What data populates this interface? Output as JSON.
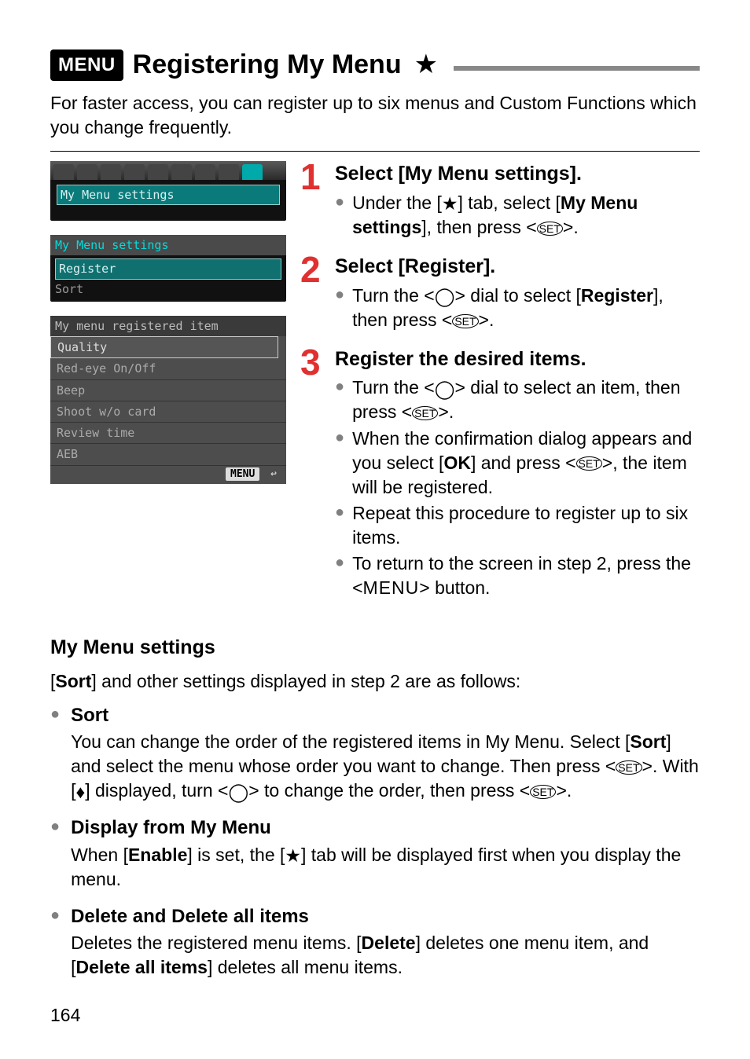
{
  "header": {
    "menu_badge": "MENU",
    "title": "Registering My Menu",
    "star": "★"
  },
  "intro": "For faster access, you can register up to six menus and Custom Functions which you change frequently.",
  "screens": {
    "s1_item": "My Menu settings",
    "s2_header": "My Menu settings",
    "s2_item1": "Register",
    "s2_item2": "Sort",
    "s3_header": "My menu registered item",
    "s3_items": [
      "Quality",
      "Red-eye On/Off",
      "Beep",
      "Shoot w/o card",
      "Review time",
      "AEB"
    ],
    "s3_menu": "MENU",
    "s3_return": "↩"
  },
  "steps": {
    "s1": {
      "num": "1",
      "head": "Select [My Menu settings].",
      "b1_pre": "Under the [",
      "b1_icon": "★",
      "b1_mid": "] tab, select [",
      "b1_bold": "My Menu settings",
      "b1_post": "], then press <",
      "b1_set": "SET",
      "b1_end": ">."
    },
    "s2": {
      "num": "2",
      "head": "Select [Register].",
      "b1_pre": "Turn the <",
      "b1_dial": "◯",
      "b1_mid": "> dial to select [",
      "b1_bold": "Register",
      "b1_post": "], then press <",
      "b1_set": "SET",
      "b1_end": ">."
    },
    "s3": {
      "num": "3",
      "head": "Register the desired items.",
      "b1_pre": "Turn the <",
      "b1_dial": "◯",
      "b1_mid": "> dial to select an item, then press <",
      "b1_set": "SET",
      "b1_end": ">.",
      "b2_pre": "When the confirmation dialog appears and you select [",
      "b2_ok": "OK",
      "b2_mid": "] and press <",
      "b2_set": "SET",
      "b2_end": ">, the item will be registered.",
      "b3": "Repeat this procedure to register up to six items.",
      "b4_pre": "To return to the screen in step 2, press the <",
      "b4_menu": "MENU",
      "b4_end": "> button."
    }
  },
  "section_header": "My Menu settings",
  "after_step_pre": "[",
  "after_step_bold": "Sort",
  "after_step_post": "] and other settings displayed in step 2 are as follows:",
  "settings": {
    "sort": {
      "title": "Sort",
      "t1": "You can change the order of the registered items in My Menu. Select [",
      "t1b": "Sort",
      "t2": "] and select the menu whose order you want to change. Then press <",
      "set1": "SET",
      "t3": ">. With [",
      "arrow": "♦",
      "t4": "] displayed, turn <",
      "dial": "◯",
      "t5": "> to change the order, then press <",
      "set2": "SET",
      "t6": ">."
    },
    "display": {
      "title": "Display from My Menu",
      "t1": "When [",
      "enable": "Enable",
      "t2": "] is set, the [",
      "icon": "★",
      "t3": "] tab will be displayed first when you display the menu."
    },
    "delete": {
      "title": "Delete and Delete all items",
      "t1": "Deletes the registered menu items. [",
      "b1": "Delete",
      "t2": "] deletes one menu item, and [",
      "b2": "Delete all items",
      "t3": "] deletes all menu items."
    }
  },
  "page_number": "164"
}
